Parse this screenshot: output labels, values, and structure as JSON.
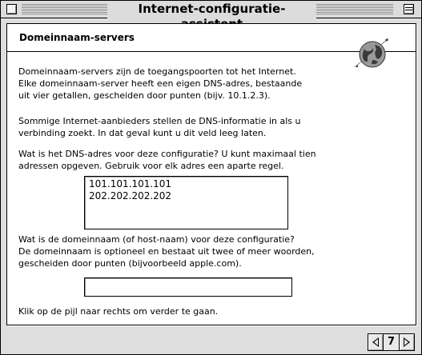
{
  "window": {
    "title": "Internet-configuratie-assistent"
  },
  "panel": {
    "section_title": "Domeinnaam-servers",
    "paragraph1": [
      "Domeinnaam-servers zijn de toegangspoorten tot het Internet.",
      "Elke domeinnaam-server heeft een eigen DNS-adres, bestaande",
      "uit vier getallen, gescheiden door punten (bijv. 10.1.2.3)."
    ],
    "paragraph2": [
      "Sommige Internet-aanbieders stellen de DNS-informatie in als u",
      "verbinding zoekt. In dat geval kunt u dit veld leeg laten."
    ],
    "paragraph3": [
      "Wat is het DNS-adres voor deze configuratie? U kunt maximaal tien",
      "adressen opgeven. Gebruik voor elk adres een aparte regel."
    ],
    "dns_addresses": [
      "101.101.101.101",
      "202.202.202.202"
    ],
    "paragraph4": [
      "Wat is de domeinnaam (of host-naam) voor deze configuratie?",
      "De domeinnaam is optioneel en bestaat uit twee of meer woorden,",
      "gescheiden door punten (bijvoorbeeld apple.com)."
    ],
    "domain_value": "",
    "paragraph5": "Klik op de pijl naar rechts om verder te gaan."
  },
  "navigation": {
    "page_number": "7"
  }
}
